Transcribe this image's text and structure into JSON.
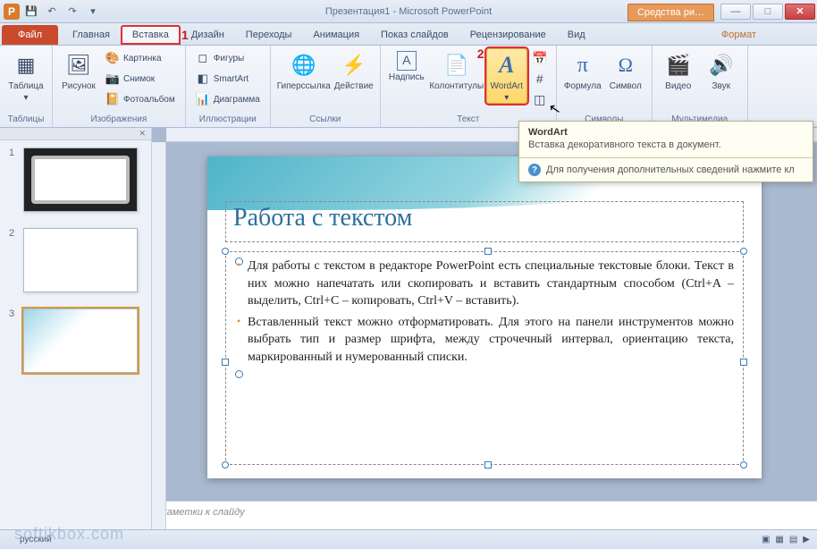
{
  "title": "Презентация1 - Microsoft PowerPoint",
  "qat": {
    "app_letter": "P"
  },
  "context_tab_title": "Средства ри…",
  "file_tab": "Файл",
  "tabs": [
    "Главная",
    "Вставка",
    "Дизайн",
    "Переходы",
    "Анимация",
    "Показ слайдов",
    "Рецензирование",
    "Вид"
  ],
  "context_tab2": "Формат",
  "callouts": {
    "tab": "1",
    "wordart": "2"
  },
  "ribbon": {
    "groups": {
      "tables": {
        "label": "Таблицы",
        "table": "Таблица"
      },
      "images": {
        "label": "Изображения",
        "picture": "Рисунок",
        "clipart": "Картинка",
        "screenshot": "Снимок",
        "album": "Фотоальбом"
      },
      "illustrations": {
        "label": "Иллюстрации",
        "shapes": "Фигуры",
        "smartart": "SmartArt",
        "chart": "Диаграмма"
      },
      "links": {
        "label": "Ссылки",
        "hyperlink": "Гиперссылка",
        "action": "Действие"
      },
      "text": {
        "label": "Текст",
        "textbox": "Надпись",
        "headerfooter": "Колонтитулы",
        "wordart": "WordArt"
      },
      "symbols": {
        "label": "Символы",
        "equation": "Формула",
        "symbol": "Символ"
      },
      "media": {
        "label": "Мультимедиа",
        "video": "Видео",
        "audio": "Звук"
      }
    }
  },
  "tooltip": {
    "title": "WordArt",
    "body": "Вставка декоративного текста в документ.",
    "help": "Для получения дополнительных сведений нажмите кл"
  },
  "thumbnails": [
    {
      "num": "1"
    },
    {
      "num": "2"
    },
    {
      "num": "3"
    }
  ],
  "slide": {
    "title": "Работа с текстом",
    "bullets": [
      "Для работы с текстом в редакторе PowerPoint есть специальные текстовые блоки. Текст в них можно напечатать или скопировать и вставить стандартным способом (Ctrl+A – выделить, Ctrl+C – копировать, Ctrl+V – вставить).",
      "Вставленный текст можно отформатировать. Для этого на панели инструментов можно выбрать тип и размер шрифта, между строчечный интервал, ориентацию текста, маркированный и нумерованный списки."
    ]
  },
  "notes_placeholder": "Заметки к слайду",
  "status": {
    "lang": "русский"
  },
  "watermark": "softikbox.com"
}
